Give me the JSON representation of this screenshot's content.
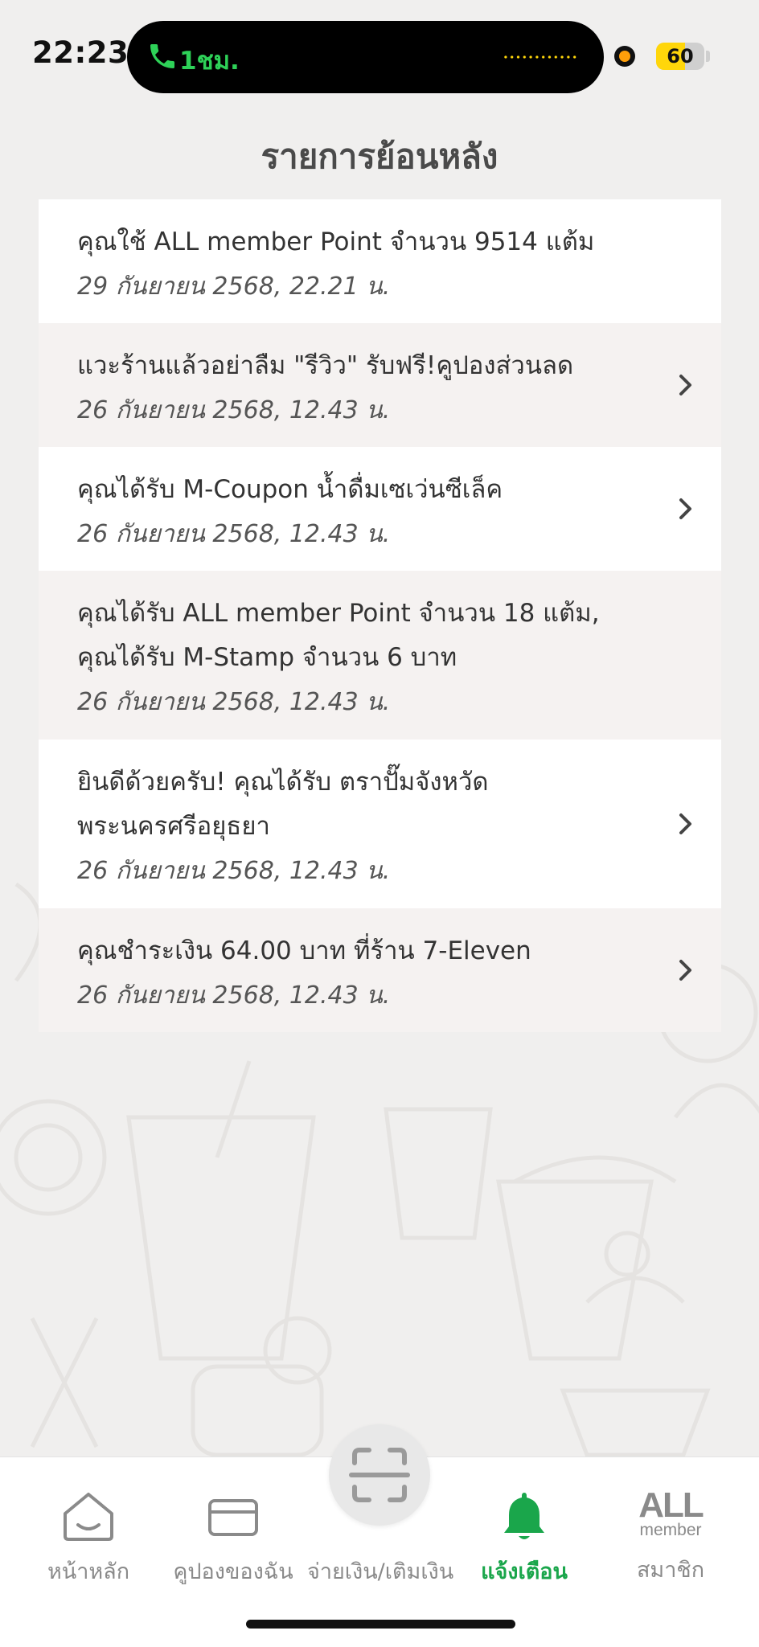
{
  "status_bar": {
    "time": "22:23",
    "call_duration": "1ชม.",
    "battery_percent": 60,
    "battery_label": "60",
    "call_color": "#2ed158",
    "battery_color": "#ffd60a"
  },
  "header": {
    "title": "รายการย้อนหลัง"
  },
  "notifications": [
    {
      "title": "คุณใช้ ALL member Point จำนวน 9514 แต้ม",
      "date": "29 กันยายน 2568, 22.21 น.",
      "has_chevron": false
    },
    {
      "title": "แวะร้านแล้วอย่าลืม \"รีวิว\" รับฟรี!คูปองส่วนลด",
      "date": "26 กันยายน 2568, 12.43 น.",
      "has_chevron": true
    },
    {
      "title": "คุณได้รับ M-Coupon น้ำดื่มเซเว่นซีเล็ค",
      "date": "26 กันยายน 2568, 12.43 น.",
      "has_chevron": true
    },
    {
      "title": "คุณได้รับ ALL member Point จำนวน 18 แต้ม, คุณได้รับ M-Stamp จำนวน 6 บาท",
      "date": "26 กันยายน 2568, 12.43 น.",
      "has_chevron": false
    },
    {
      "title": "ยินดีด้วยครับ! คุณได้รับ ตราปั๊มจังหวัดพระนครศรีอยุธยา",
      "date": "26 กันยายน 2568, 12.43 น.",
      "has_chevron": true
    },
    {
      "title": "คุณชำระเงิน 64.00 บาท ที่ร้าน 7-Eleven",
      "date": "26 กันยายน 2568, 12.43 น.",
      "has_chevron": true
    }
  ],
  "nav": {
    "home": {
      "label": "หน้าหลัก",
      "icon": "home-icon"
    },
    "coupons": {
      "label": "คูปองของฉัน",
      "icon": "card-icon"
    },
    "pay": {
      "label": "จ่ายเงิน/เติมเงิน",
      "icon": "scan-icon"
    },
    "alerts": {
      "label": "แจ้งเตือน",
      "icon": "bell-icon",
      "active": true
    },
    "member": {
      "label": "สมาชิก",
      "logo_top": "ALL",
      "logo_bottom": "member"
    },
    "active_color": "#1aa64b",
    "inactive_color": "#8a8a8a"
  }
}
